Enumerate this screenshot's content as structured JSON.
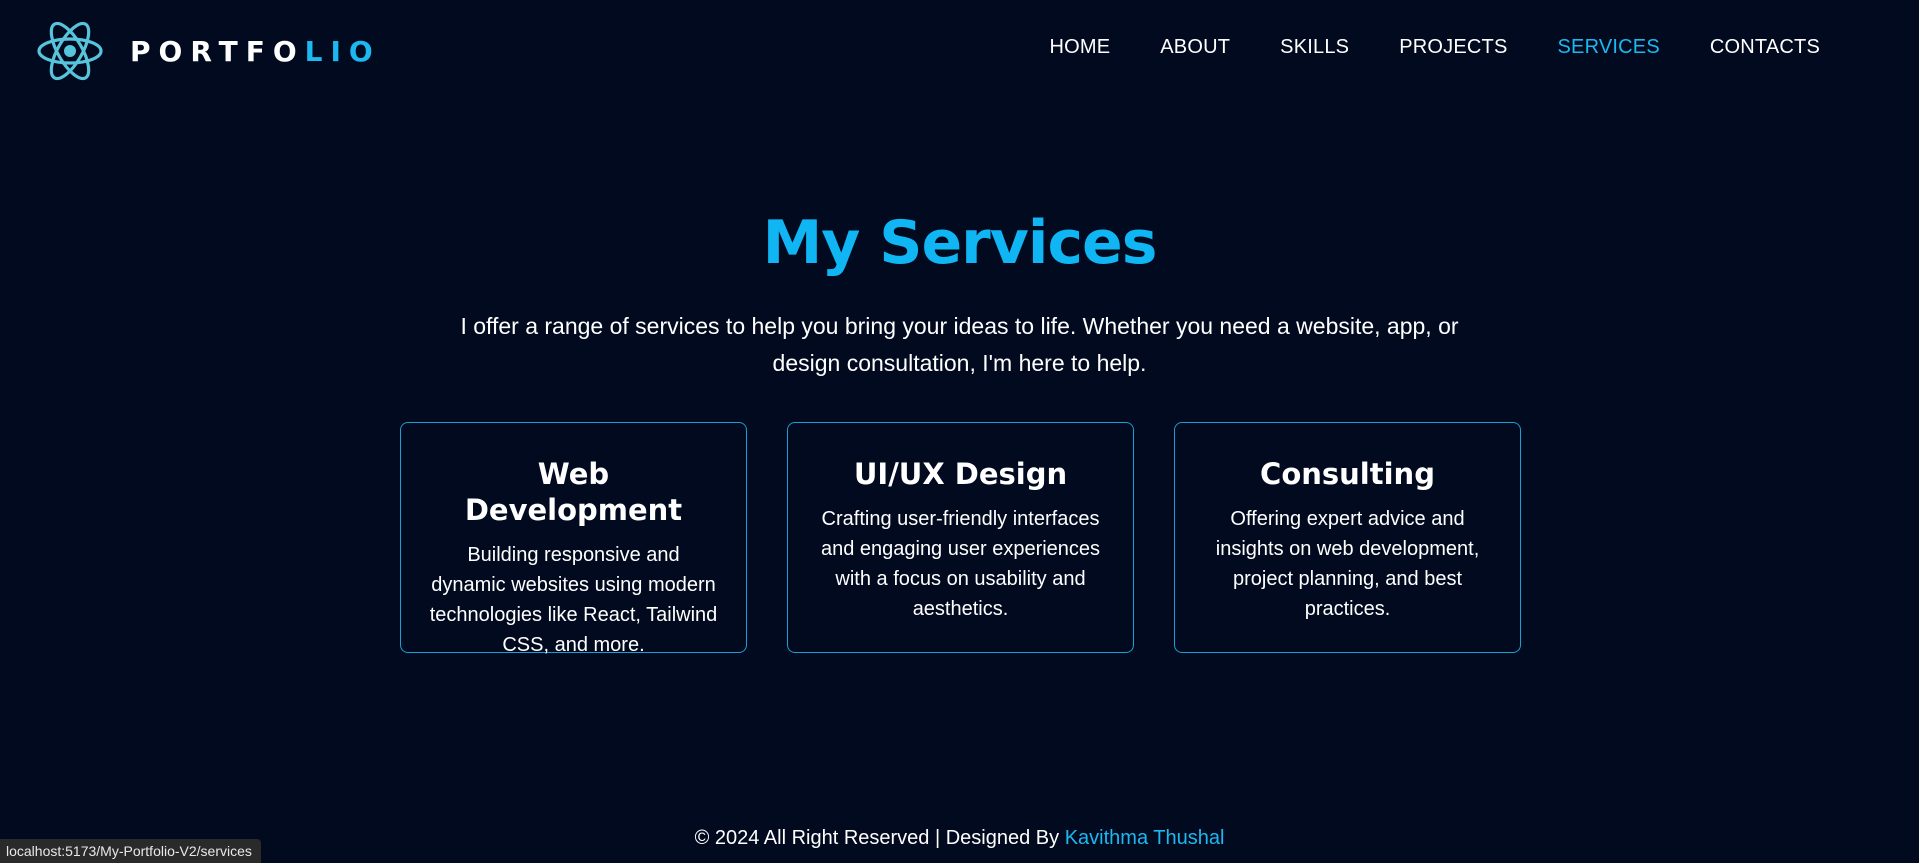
{
  "header": {
    "logo": {
      "text_main": "PORTFO",
      "text_accent": "LIO",
      "icon": "react-atom-icon"
    },
    "nav": {
      "items": [
        {
          "label": "HOME",
          "active": false
        },
        {
          "label": "ABOUT",
          "active": false
        },
        {
          "label": "SKILLS",
          "active": false
        },
        {
          "label": "PROJECTS",
          "active": false
        },
        {
          "label": "SERVICES",
          "active": true
        },
        {
          "label": "CONTACTS",
          "active": false
        }
      ]
    }
  },
  "main": {
    "title": "My Services",
    "intro": "I offer a range of services to help you bring your ideas to life. Whether you need a website, app, or design consultation, I'm here to help.",
    "services": [
      {
        "title": "Web Development",
        "description": "Building responsive and dynamic websites using modern technologies like React, Tailwind CSS, and more."
      },
      {
        "title": "UI/UX Design",
        "description": "Crafting user-friendly interfaces and engaging user experiences with a focus on usability and aesthetics."
      },
      {
        "title": "Consulting",
        "description": "Offering expert advice and insights on web development, project planning, and best practices."
      }
    ]
  },
  "footer": {
    "text": "© 2024 All Right Reserved | Designed By ",
    "author": "Kavithma Thushal"
  },
  "status_bar": {
    "url": "localhost:5173/My-Portfolio-V2/services"
  },
  "colors": {
    "background": "#010a1f",
    "accent": "#1cb8f0",
    "text": "#ffffff",
    "card_border": "#1a9fd4"
  }
}
